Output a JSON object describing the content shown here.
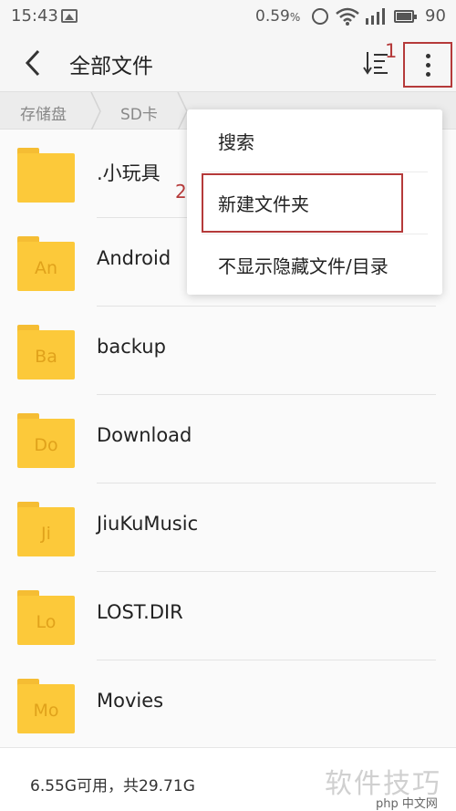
{
  "status_bar": {
    "time": "15:43",
    "network_speed": "0.59",
    "battery_level": "90",
    "icons": [
      "image-icon",
      "alarm-icon",
      "wifi-icon",
      "signal-icon",
      "battery-icon"
    ]
  },
  "header": {
    "title": "全部文件",
    "sort_icon": "sort-icon",
    "more_icon": "more-vertical-icon"
  },
  "breadcrumb": [
    "存储盘",
    "SD卡"
  ],
  "files": [
    {
      "name": ".小玩具",
      "abbr": ""
    },
    {
      "name": "Android",
      "abbr": "An"
    },
    {
      "name": "backup",
      "abbr": "Ba"
    },
    {
      "name": "Download",
      "abbr": "Do"
    },
    {
      "name": "JiuKuMusic",
      "abbr": "Ji"
    },
    {
      "name": "LOST.DIR",
      "abbr": "Lo"
    },
    {
      "name": "Movies",
      "abbr": "Mo"
    }
  ],
  "menu": {
    "items": [
      "搜索",
      "新建文件夹",
      "不显示隐藏文件/目录"
    ]
  },
  "annotations": {
    "step1": "1",
    "step2": "2"
  },
  "footer": {
    "storage": "6.55G可用，共29.71G",
    "watermark": "软件技巧",
    "logo_text": "php 中文网"
  },
  "colors": {
    "folder": "#fcc93a",
    "annotation": "#b53a3a",
    "background": "#f6f6f6"
  }
}
